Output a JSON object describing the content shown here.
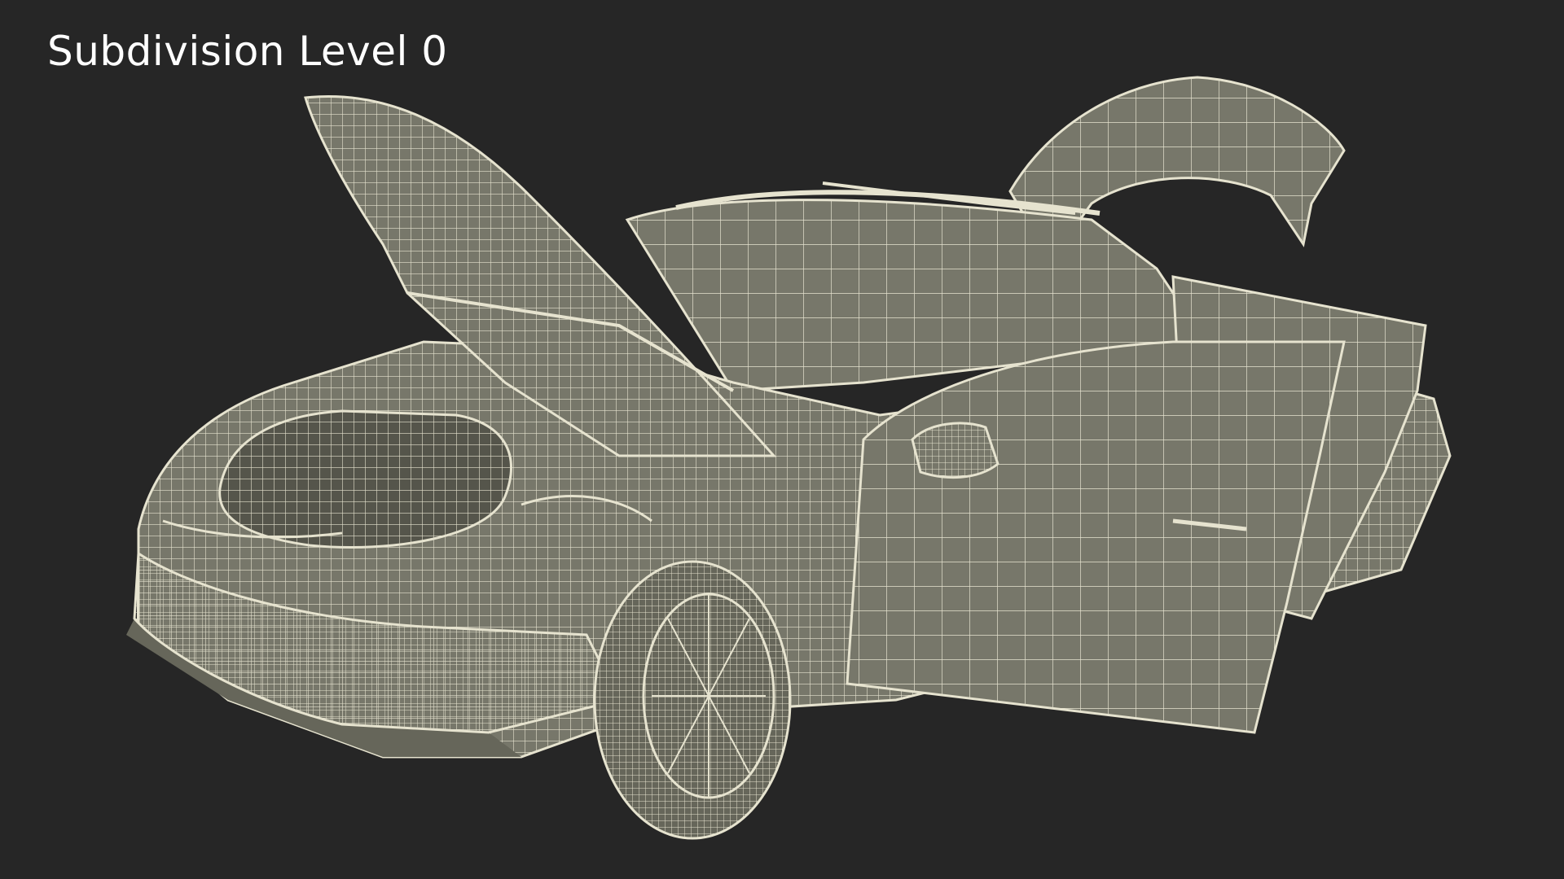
{
  "caption": "Subdivision Level 0",
  "colors": {
    "background": "#262626",
    "mesh_surface": "#77776a",
    "wire": "#e6e3cf",
    "caption_text": "#ffffff"
  }
}
